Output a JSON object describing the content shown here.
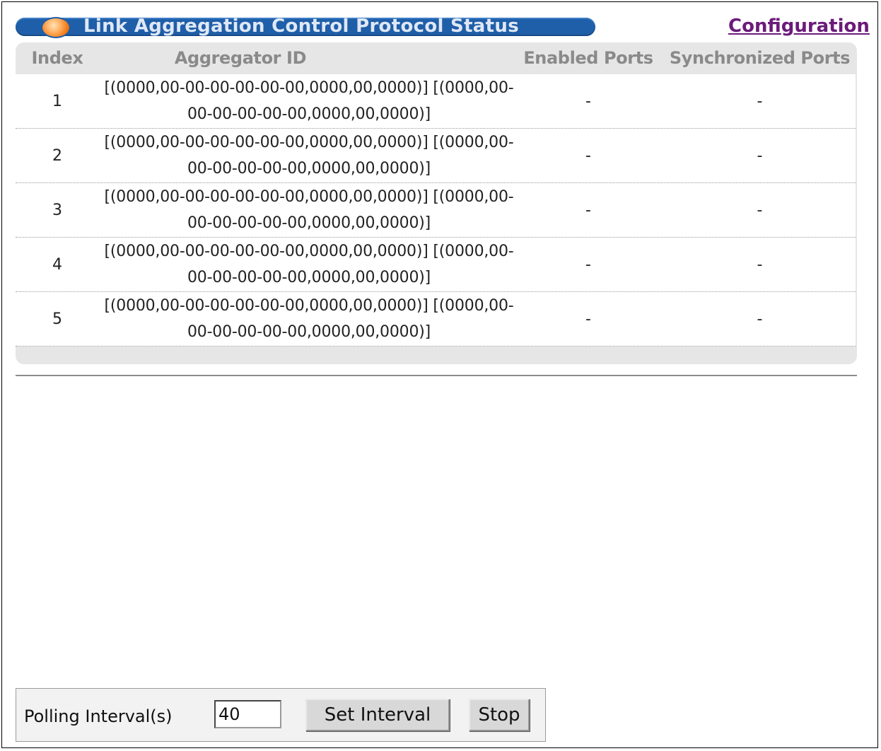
{
  "header": {
    "title": "Link Aggregation Control Protocol Status",
    "configuration_link": "Configuration"
  },
  "table": {
    "columns": [
      "Index",
      "Aggregator ID",
      "Enabled Ports",
      "Synchronized Ports"
    ],
    "rows": [
      {
        "index": "1",
        "aggregator_id": "[(0000,00-00-00-00-00-00,0000,00,0000)] [(0000,00-00-00-00-00-00,0000,00,0000)]",
        "enabled_ports": "-",
        "synchronized_ports": "-"
      },
      {
        "index": "2",
        "aggregator_id": "[(0000,00-00-00-00-00-00,0000,00,0000)] [(0000,00-00-00-00-00-00,0000,00,0000)]",
        "enabled_ports": "-",
        "synchronized_ports": "-"
      },
      {
        "index": "3",
        "aggregator_id": "[(0000,00-00-00-00-00-00,0000,00,0000)] [(0000,00-00-00-00-00-00,0000,00,0000)]",
        "enabled_ports": "-",
        "synchronized_ports": "-"
      },
      {
        "index": "4",
        "aggregator_id": "[(0000,00-00-00-00-00-00,0000,00,0000)] [(0000,00-00-00-00-00-00,0000,00,0000)]",
        "enabled_ports": "-",
        "synchronized_ports": "-"
      },
      {
        "index": "5",
        "aggregator_id": "[(0000,00-00-00-00-00-00,0000,00,0000)] [(0000,00-00-00-00-00-00,0000,00,0000)]",
        "enabled_ports": "-",
        "synchronized_ports": "-"
      }
    ]
  },
  "polling": {
    "label": "Polling Interval(s)",
    "value": "40",
    "set_interval_label": "Set Interval",
    "stop_label": "Stop"
  },
  "colors": {
    "title_bar": "#1f5ea8",
    "link": "#6b1a7a",
    "header_text": "#8a8a8a"
  }
}
